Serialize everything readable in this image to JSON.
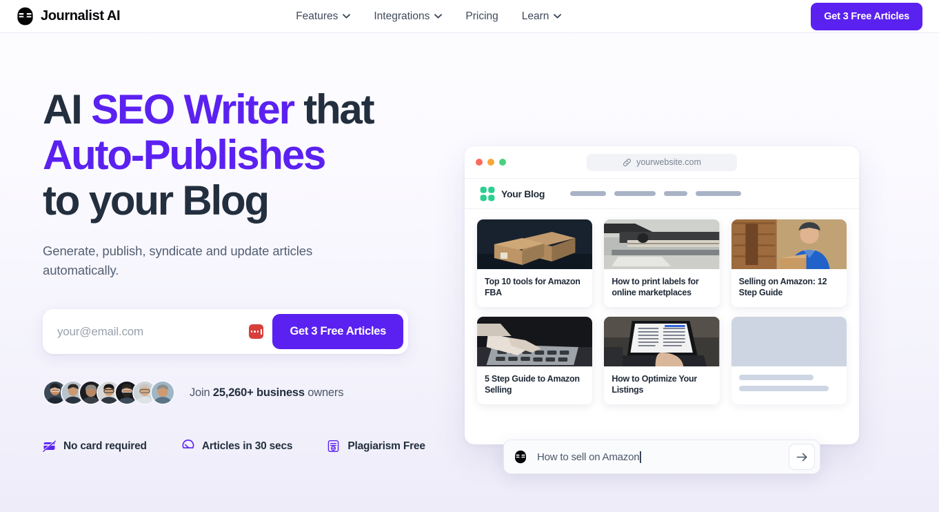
{
  "brand": {
    "name": "Journalist AI",
    "logo_icon": "journalist-ai-mascot-icon"
  },
  "nav": {
    "items": [
      {
        "label": "Features",
        "has_dropdown": true,
        "icon": "chevron-down-icon"
      },
      {
        "label": "Integrations",
        "has_dropdown": true,
        "icon": "chevron-down-icon"
      },
      {
        "label": "Pricing",
        "has_dropdown": false,
        "icon": ""
      },
      {
        "label": "Learn",
        "has_dropdown": true,
        "icon": "chevron-down-icon"
      }
    ],
    "cta_label": "Get 3 Free Articles"
  },
  "hero": {
    "headline": {
      "line1_plain": "AI ",
      "line1_accent": "SEO Writer",
      "line1_tail": " that",
      "line2_accent": "Auto-Publishes",
      "line3_plain": "to your Blog"
    },
    "subhead": "Generate, publish, syndicate and update articles automatically.",
    "form": {
      "email_placeholder": "your@email.com",
      "email_value": "",
      "password_manager_icon": "password-autofill-icon",
      "submit_label": "Get 3 Free Articles"
    },
    "social_proof": {
      "prefix": "Join ",
      "count": "25,260+ business",
      "suffix": " owners",
      "avatar_count": 7
    },
    "badges": [
      {
        "label": "No card required",
        "icon": "card-off-icon"
      },
      {
        "label": "Articles in 30 secs",
        "icon": "speedometer-icon"
      },
      {
        "label": "Plagiarism Free",
        "icon": "document-check-icon"
      }
    ]
  },
  "mockup": {
    "window_dots": [
      "red",
      "yellow",
      "green"
    ],
    "url": "yourwebsite.com",
    "url_icon": "link-icon",
    "blog": {
      "logo_icon": "clover-logo-icon",
      "name": "Your Blog",
      "nav_placeholder_widths": [
        52,
        60,
        34,
        66
      ]
    },
    "cards": [
      {
        "title": "Top 10 tools for Amazon FBA",
        "skeleton": false
      },
      {
        "title": "How to print labels for online marketplaces",
        "skeleton": false
      },
      {
        "title": "Selling on Amazon: 12 Step Guide",
        "skeleton": false
      },
      {
        "title": "5 Step Guide to Amazon Selling",
        "skeleton": false
      },
      {
        "title": "How to Optimize Your Listings",
        "skeleton": false
      },
      {
        "title": "",
        "skeleton": true
      }
    ],
    "prompt": {
      "icon": "journalist-ai-mascot-icon",
      "text": "How to sell on Amazon",
      "send_icon": "arrow-right-icon"
    }
  },
  "colors": {
    "accent_purple": "#5b21f0",
    "headline_dark": "#232f3e",
    "body_text": "#525f72",
    "page_bg": "#f4f3fc",
    "blog_green": "#2bcf8f",
    "password_icon_red": "#d73f3b"
  }
}
